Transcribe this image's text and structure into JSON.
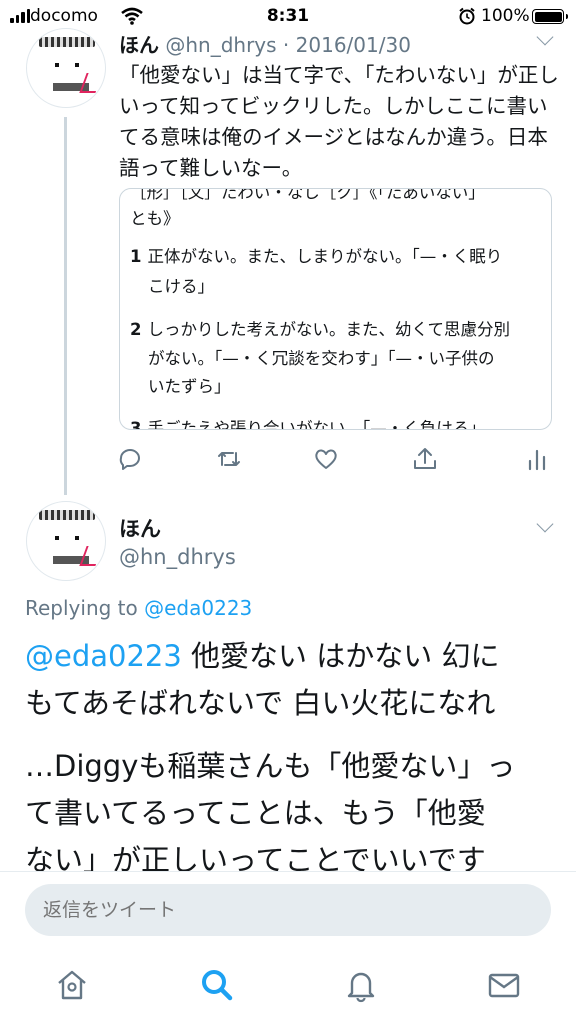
{
  "status_bar": {
    "carrier": "docomo",
    "time": "8:31",
    "battery": "100%"
  },
  "tweet1": {
    "name": "ほん",
    "handle": "@hn_dhrys",
    "separator": "·",
    "date": "2016/01/30",
    "text": "「他愛ない」は当て字で、「たわいない」が正しいって知ってビックリした。しかしここに書いてる意味は俺のイメージとはなんか違う。日本語って難しいなー。",
    "quote": {
      "cut_line": "［形］［文］たわい・なし［ク］《「たあいない」",
      "line0": "とも》",
      "def1_num": "1",
      "def1_l1": "正体がない。また、しまりがない。「—・く眠り",
      "def1_l2": "こける」",
      "def2_num": "2",
      "def2_l1": "しっかりした考えがない。また、幼くて思慮分別",
      "def2_l2": "がない。「—・く冗談を交わす」「—・い子供の",
      "def2_l3": "いたずら」",
      "def3_num": "3",
      "def3_l1": "手ごたえや張り合いがない。「—・く負ける」"
    }
  },
  "tweet2": {
    "name": "ほん",
    "handle": "@hn_dhrys",
    "replying_label": "Replying to",
    "replying_handle": "@eda0223",
    "line1_mention": "@eda0223",
    "line1_rest": " 他愛ない はかない 幻に",
    "line2": "もてあそばれないで 白い火花になれ",
    "line3": "…Diggyも稲葉さんも「他愛ない」っ",
    "line4": "て書いてるってことは、もう「他愛",
    "line5": "ない」が正しいってことでいいです"
  },
  "composer": {
    "placeholder": "返信をツイート"
  },
  "tab_bar": {
    "items": [
      "home-icon",
      "search-icon",
      "notifications-icon",
      "messages-icon"
    ],
    "active": "search-icon"
  },
  "colors": {
    "accent": "#1da1f2",
    "icon_gray": "#657786",
    "thread_line": "#ccd6dd"
  }
}
